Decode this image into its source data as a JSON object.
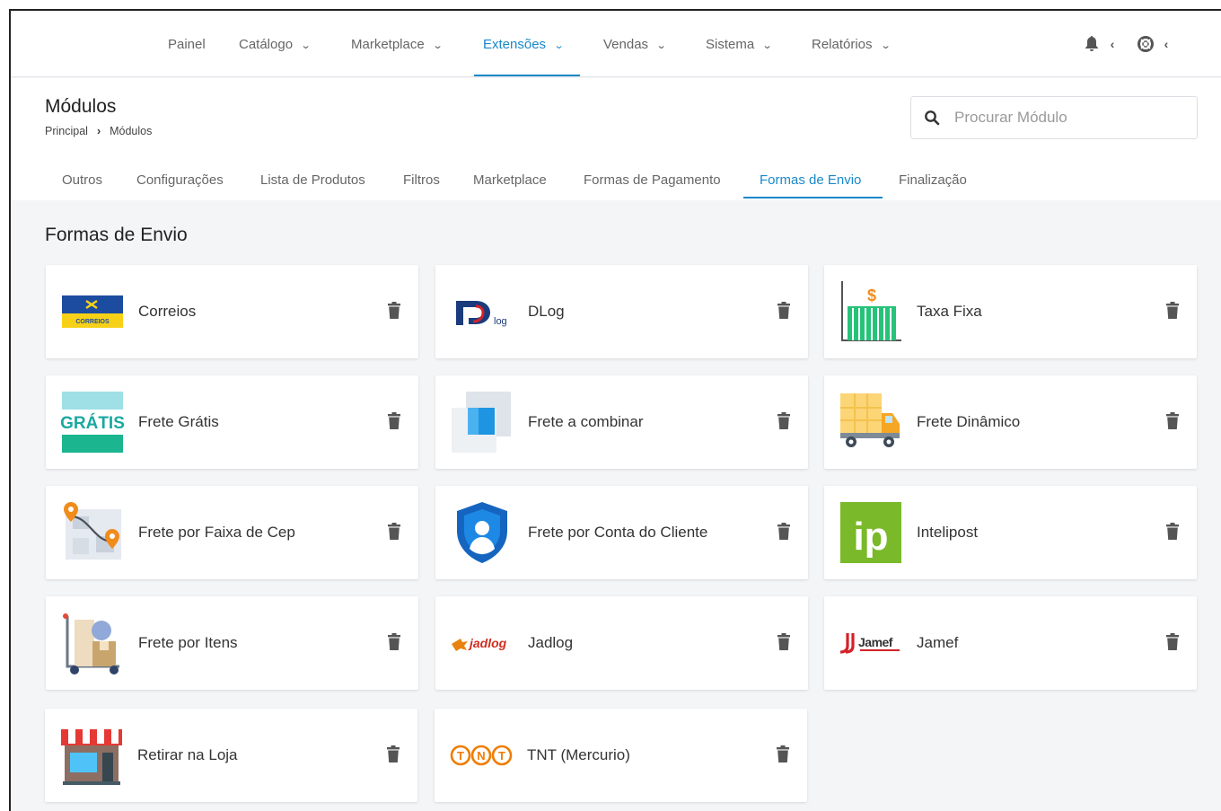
{
  "topnav": {
    "items": [
      {
        "label": "Painel",
        "has_dropdown": false
      },
      {
        "label": "Catálogo",
        "has_dropdown": true
      },
      {
        "label": "Marketplace",
        "has_dropdown": true
      },
      {
        "label": "Extensões",
        "has_dropdown": true,
        "active": true
      },
      {
        "label": "Vendas",
        "has_dropdown": true
      },
      {
        "label": "Sistema",
        "has_dropdown": true
      },
      {
        "label": "Relatórios",
        "has_dropdown": true
      }
    ],
    "chevron": "▾",
    "icons": [
      "bell-icon",
      "chevron-left-icon",
      "lifebuoy-icon",
      "chevron-left-icon"
    ],
    "accent": "#1a88c9"
  },
  "header": {
    "title": "Módulos",
    "breadcrumb": [
      "Principal",
      "Módulos"
    ],
    "breadcrumb_sep": "›",
    "search_placeholder": "Procurar Módulo"
  },
  "tabs": [
    {
      "label": "Outros"
    },
    {
      "label": "Configurações"
    },
    {
      "label": "Lista de Produtos"
    },
    {
      "label": "Filtros"
    },
    {
      "label": "Marketplace"
    },
    {
      "label": "Formas de Pagamento"
    },
    {
      "label": "Formas de Envio",
      "active": true
    },
    {
      "label": "Finalização"
    }
  ],
  "section": {
    "title": "Formas de Envio"
  },
  "modules": [
    {
      "label": "Correios",
      "icon": "correios-logo",
      "logo_text": "CORREIOS"
    },
    {
      "label": "DLog",
      "icon": "dlog-logo",
      "logo_text": "log"
    },
    {
      "label": "Taxa Fixa",
      "icon": "fixed-rate-icon",
      "logo_text": "$"
    },
    {
      "label": "Frete Grátis",
      "icon": "free-shipping-icon",
      "logo_text": "GRÁTIS"
    },
    {
      "label": "Frete a combinar",
      "icon": "negotiable-shipping-icon"
    },
    {
      "label": "Frete Dinâmico",
      "icon": "truck-icon"
    },
    {
      "label": "Frete por Faixa de Cep",
      "icon": "map-route-icon"
    },
    {
      "label": "Frete por Conta do Cliente",
      "icon": "shield-user-icon"
    },
    {
      "label": "Intelipost",
      "icon": "intelipost-logo",
      "logo_text": "ip"
    },
    {
      "label": "Frete por Itens",
      "icon": "hand-truck-icon"
    },
    {
      "label": "Jadlog",
      "icon": "jadlog-logo",
      "logo_text": "jadlog"
    },
    {
      "label": "Jamef",
      "icon": "jamef-logo",
      "logo_text": "Jamef"
    },
    {
      "label": "Retirar na Loja",
      "icon": "storefront-icon"
    },
    {
      "label": "TNT (Mercurio)",
      "icon": "tnt-logo",
      "logo_text": "TNT"
    }
  ]
}
